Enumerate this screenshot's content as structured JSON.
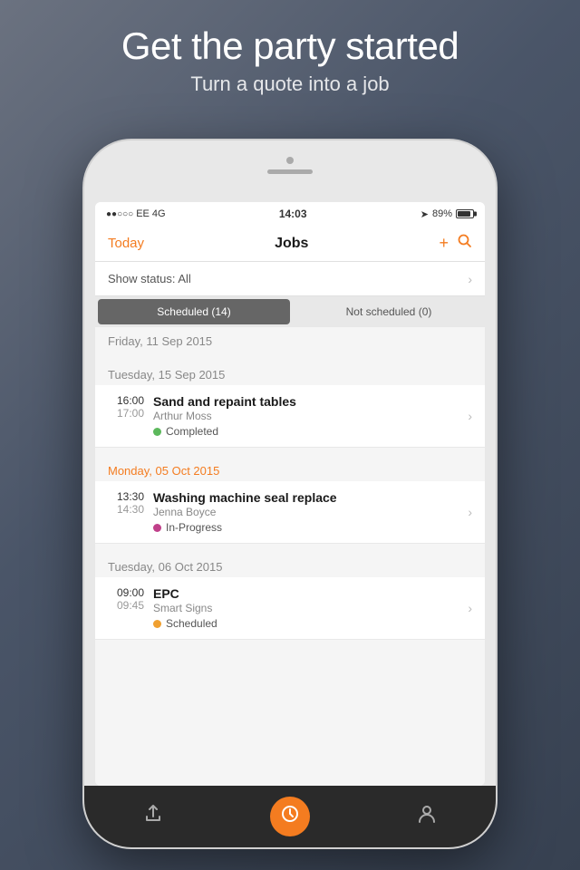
{
  "background": {
    "headline": "Get the party started",
    "subheadline": "Turn a quote into a job"
  },
  "statusBar": {
    "signal": "●●○○○",
    "carrier": "EE  4G",
    "time": "14:03",
    "arrow": "➤",
    "battery_pct": "89%"
  },
  "navBar": {
    "today_label": "Today",
    "title": "Jobs",
    "add_icon": "+",
    "search_icon": "🔍"
  },
  "showStatus": {
    "label": "Show status: All"
  },
  "tabs": {
    "scheduled_label": "Scheduled (14)",
    "not_scheduled_label": "Not scheduled (0)"
  },
  "sections": [
    {
      "date": "Friday, 11 Sep 2015",
      "color": "normal",
      "jobs": []
    },
    {
      "date": "Tuesday, 15 Sep 2015",
      "color": "normal",
      "jobs": [
        {
          "start": "16:00",
          "end": "17:00",
          "title": "Sand and repaint tables",
          "person": "Arthur Moss",
          "status": "Completed",
          "status_color": "#5cb85c"
        }
      ]
    },
    {
      "date": "Monday, 05 Oct 2015",
      "color": "orange",
      "jobs": [
        {
          "start": "13:30",
          "end": "14:30",
          "title": "Washing machine seal replace",
          "person": "Jenna Boyce",
          "status": "In-Progress",
          "status_color": "#c0408a"
        }
      ]
    },
    {
      "date": "Tuesday, 06 Oct 2015",
      "color": "normal",
      "jobs": [
        {
          "start": "09:00",
          "end": "09:45",
          "title": "EPC",
          "person": "Smart Signs",
          "status": "Scheduled",
          "status_color": "#f0a030"
        }
      ]
    }
  ],
  "bottomBar": {
    "share_icon": "⬆",
    "clock_icon": "L",
    "person_icon": "👤"
  },
  "colors": {
    "orange": "#f47c20",
    "completed": "#5cb85c",
    "in_progress": "#c0408a",
    "scheduled": "#f0a030"
  }
}
